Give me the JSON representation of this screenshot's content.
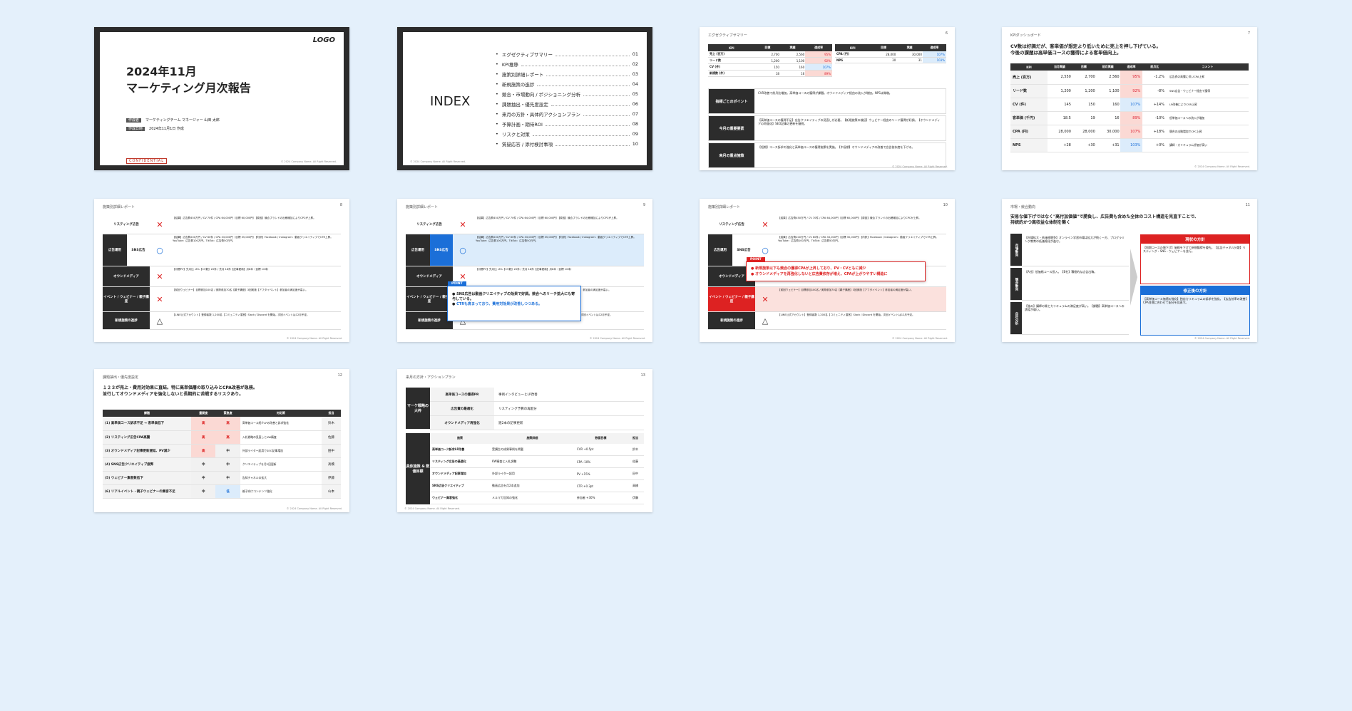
{
  "copyright": "© 2024 Company Name. All Right Reserved.",
  "cover": {
    "logo": "LOGO",
    "title_line1": "2024年11月",
    "title_line2": "マーケティング月次報告",
    "author_label": "作成者",
    "author": "マーケティングチーム マネージャー 山田 太郎",
    "date_label": "作成日時",
    "date": "2024年11月1日 作成",
    "confidential": "CONFIDENTIAL"
  },
  "index": {
    "title": "INDEX",
    "items": [
      {
        "label": "エグゼクティブサマリー",
        "num": "01"
      },
      {
        "label": "KPI推移",
        "num": "02"
      },
      {
        "label": "施策別詳細レポート",
        "num": "03"
      },
      {
        "label": "新規施策の進捗",
        "num": "04"
      },
      {
        "label": "競合・市場動向 / ポジショニング分析",
        "num": "05"
      },
      {
        "label": "課題抽出・優先度設定",
        "num": "06"
      },
      {
        "label": "来月の方針・具体的アクションプラン",
        "num": "07"
      },
      {
        "label": "予算計画・期待ROI",
        "num": "08"
      },
      {
        "label": "リスクと対策",
        "num": "09"
      },
      {
        "label": "質疑応答 / 添付検討事項",
        "num": "10"
      }
    ]
  },
  "summary": {
    "section": "エグゼクティブサマリー",
    "page": "6",
    "kpi_left": [
      {
        "kpi": "売上 (百万)",
        "v1": "2,700",
        "v2": "2,560",
        "rate": "95%"
      },
      {
        "kpi": "リード数",
        "v1": "1,200",
        "v2": "1,100",
        "rate": "92%"
      },
      {
        "kpi": "CV (件)",
        "v1": "150",
        "v2": "160",
        "rate": "107%"
      },
      {
        "kpi": "新規数 (件)",
        "v1": "18",
        "v2": "16",
        "rate": "89%"
      }
    ],
    "kpi_right": [
      {
        "kpi": "CPA (円)",
        "v1": "28,000",
        "v2": "30,000",
        "rate": "107%"
      },
      {
        "kpi": "NPS",
        "v1": "30",
        "v2": "31",
        "rate": "103%"
      }
    ],
    "rows": [
      {
        "label": "指標ごとのポイント",
        "text": "CVR改善で前月比増加。高単価コースの獲得が課題。オウンドメディア経由の流入が増加。NPSは微増。"
      },
      {
        "label": "今月の重要要素",
        "text": "【高単価コースの獲得不足】広告クリエイティブの見直しが必要。【新規施策の検証】ウェビナー経由のリード獲得が好調。【オウンドメディアの再強化】SEO記事の更新を継続。"
      },
      {
        "label": "来月の重点施策",
        "text": "【短期】コース訴求の強化と高単価コースの獲得施策を実施。【中長期】オウンドメディアの改善で広告依存度を下げる。"
      }
    ]
  },
  "kpi": {
    "section": "KPIダッシュボード",
    "page": "7",
    "headline1": "CV数は好調だが、客単価が想定より低いために売上を押し下げている。",
    "headline2": "今後の課題は高単価コースの獲得による客単価向上。",
    "headers": [
      "KPI",
      "当月実績",
      "目標",
      "前月実績",
      "達成率",
      "前月比",
      "コメント"
    ],
    "rows": [
      {
        "kpi": "売上 (百万)",
        "a": "2,550",
        "b": "2,700",
        "c": "2,560",
        "rate": "95%",
        "diff": "-1.2%",
        "tone": "red",
        "comment": "広告費の高騰に伴いCPA上昇"
      },
      {
        "kpi": "リード数",
        "a": "1,200",
        "b": "1,200",
        "c": "1,100",
        "rate": "92%",
        "diff": "-8%",
        "tone": "red",
        "comment": "SNS広告・ウェビナー経由で獲得"
      },
      {
        "kpi": "CV (件)",
        "a": "145",
        "b": "150",
        "c": "160",
        "rate": "107%",
        "diff": "+14%",
        "tone": "blue",
        "comment": "LP改善によりCVR上昇"
      },
      {
        "kpi": "客単価 (千円)",
        "a": "18.5",
        "b": "19",
        "c": "16",
        "rate": "89%",
        "diff": "-10%",
        "tone": "red",
        "comment": "低単価コースへの流入が増加"
      },
      {
        "kpi": "CPA (円)",
        "a": "28,000",
        "b": "28,000",
        "c": "30,000",
        "rate": "107%",
        "diff": "+18%",
        "tone": "red",
        "comment": "競合の出稿増加でCPC上昇"
      },
      {
        "kpi": "NPS",
        "a": "+28",
        "b": "+30",
        "c": "+31",
        "rate": "103%",
        "diff": "+0%",
        "tone": "blue",
        "comment": "講師・カリキュラム評価が高い"
      }
    ]
  },
  "detail": {
    "section": "施策別詳細レポート",
    "pages": [
      "8",
      "9",
      "10"
    ],
    "rows": [
      {
        "label": "リスティング広告",
        "sub": "",
        "mark": "✕",
        "text": "【結果】広告費450万円 / CV 70件 / CPA 64,000円（目標 60,000円）【原因】競合ブランドの出稿増加によりCPCが上昇。"
      },
      {
        "label": "広告運用",
        "sub": "SNS広告",
        "mark": "○",
        "text": "【結果】広告費200万円 / CV 60件 / CPA 33,000円（目標 35,000円）【内訳】Facebook / Instagram：動画クリエイティブでCTR上昇。YouTube：広告費100万円。TikTok：広告費50万円。"
      },
      {
        "label": "オウンドメディア",
        "sub": "",
        "mark": "✕",
        "text": "【月間PV】先月比 -8%【CV数】20件 / 先月 18件【記事更新】月8本（目標 10本）"
      },
      {
        "label": "イベント / ウェビナー / 親子講座",
        "sub": "",
        "mark": "✕",
        "text": "【前回ウェビナー】目標参加100名 / 実際参加70名【親子講座】3回実施【アフタイベント】参加者の満足度が高い。"
      },
      {
        "label": "新規施策の進捗",
        "sub": "",
        "mark": "△",
        "text": "【LINE公式アカウント】登録者数 1,200名【コミュニティ運営】Slack / Discord を開始。次回イベントは12月予定。"
      }
    ],
    "point_label": "POINT",
    "point_b1": "SNS広告は動画クリエイティブの効果で好調。競合へのリーチ拡大にも寄与している。",
    "point_b2": "CTRも高まっており、費用対効果が改善しつつある。",
    "point_c1": "新規施策以下も競合の獲得CPAが上昇しており、PV・CVともに減少",
    "point_c2": "オウンドメディアを再強化しないと広告費依存が増え、CPAが上がりやすい構造に"
  },
  "market": {
    "section": "市場・競合動向",
    "page": "11",
    "headline1": "安易な値下げではなく\"高付加価値\"で勝負し、広告費も含めた全体のコスト構造を見直すことで、",
    "headline2": "持続的かつ高収益な体制を築く",
    "left": [
      {
        "label": "市場動向",
        "text": "【市場拡大・低価格競争】オンライン学習市場は拡大が続く一方、プログラミング教育の低価格化が進む。"
      },
      {
        "label": "競合動向",
        "text": "【A社】低価格コース投入。【B社】積極的な広告出稿。"
      },
      {
        "label": "自社分析",
        "text": "【強み】講師の質とカリキュラムの満足度が高い。【課題】高単価コースへの誘導が弱い。"
      }
    ],
    "current_title": "現状の方針",
    "current_text": "【短期コースの値下げ】価格を下げて新規獲得を優先。【広告チャネル分散】リスティング・SNS・ウェビナーを並行。",
    "revised_title": "修正後の方針",
    "revised_text": "【高単価コース価値の強化】独自カリキュラムの訴求を強化。【広告効率の改善】CPA目標に合わせて配分を見直す。"
  },
  "issues": {
    "section": "課題抽出・優先度設定",
    "page": "12",
    "headline1": "１２３が売上・費用対効果に直結。特に高単価層の取り込みとCPA改善が急務。",
    "headline2": "並行してオウンドメディアを強化しないと長期的に苦戦するリスクあり。",
    "headers": [
      "課題",
      "重要度",
      "緊急度",
      "対応策",
      "担当"
    ],
    "rows": [
      {
        "issue": "(1) 高単価コース訴求不足 → 客単価低下",
        "imp": "高",
        "urg": "高",
        "plan": "高単価コース紹介LPの改善と訴求強化",
        "owner": "鈴木"
      },
      {
        "issue": "(2) リスティング広告CPA高騰",
        "imp": "高",
        "urg": "高",
        "plan": "入札戦略の見直しとKW精査",
        "owner": "佐藤"
      },
      {
        "issue": "(3) オウンドメディア記事更新遅延、PV減少",
        "imp": "高",
        "urg": "中",
        "plan": "外部ライター起用でSEO記事増加",
        "owner": "田中"
      },
      {
        "issue": "(4) SNS広告クリエイティブ疲弊",
        "imp": "中",
        "urg": "中",
        "plan": "クリエイティブを月2回更新",
        "owner": "高橋"
      },
      {
        "issue": "(5) ウェビナー集客数低下",
        "imp": "中",
        "urg": "中",
        "plan": "告知チャネルの拡大",
        "owner": "伊藤"
      },
      {
        "issue": "(6) リアルイベント・親子ウェビナーの集客不足",
        "imp": "中",
        "urg": "低",
        "plan": "親子向けコンテンツ強化",
        "owner": "山本"
      }
    ]
  },
  "action": {
    "section": "来月の方針・アクションプラン",
    "page": "13",
    "top_label": "マーケ戦略の大枠",
    "top_rows": [
      {
        "k": "高単価コースの獲得PR",
        "v": "事例インタビューとLP改善"
      },
      {
        "k": "広告費の最適化",
        "v": "リスティング予算の再配分"
      },
      {
        "k": "オウンドメディア再強化",
        "v": "週2本の記事更新"
      }
    ],
    "bottom_label": "具体施策 & 数値目標",
    "headers": [
      "施策",
      "施策詳細",
      "数値目標",
      "担当"
    ],
    "rows": [
      {
        "a": "高単価コース訴求LP改善",
        "b": "受講生の成果事例を掲載",
        "c": "CVR +0.5pt",
        "d": "鈴木"
      },
      {
        "a": "リスティング広告の最適化",
        "b": "KW精査と入札調整",
        "c": "CPA -10%",
        "d": "佐藤"
      },
      {
        "a": "オウンドメディア記事増加",
        "b": "外部ライター起用",
        "c": "PV +15%",
        "d": "田中"
      },
      {
        "a": "SNS広告クリエイティブ",
        "b": "動画広告を月2本追加",
        "c": "CTR +0.3pt",
        "d": "高橋"
      },
      {
        "a": "ウェビナー集客強化",
        "b": "メルマガ告知の強化",
        "c": "参加者 +30%",
        "d": "伊藤"
      }
    ]
  }
}
